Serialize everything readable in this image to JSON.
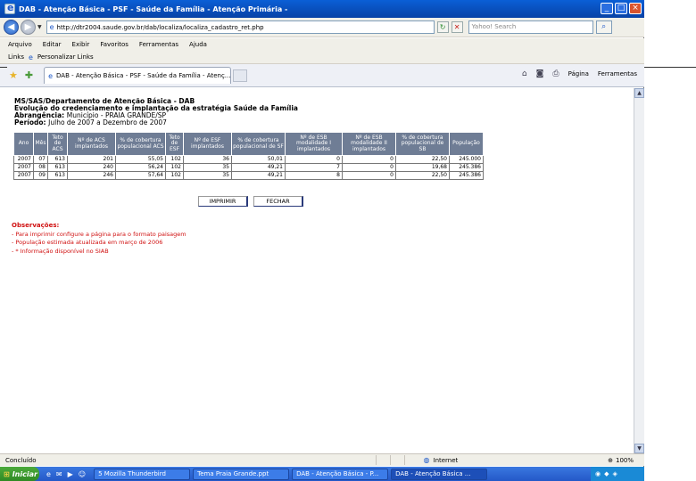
{
  "window": {
    "title": "DAB - Atenção Básica - PSF - Saúde da Família - Atenção Primária -",
    "buttons": [
      "_",
      "□",
      "×"
    ]
  },
  "address": {
    "url": "http://dtr2004.saude.gov.br/dab/localiza/localiza_cadastro_ret.php",
    "search_placeholder": "Yahoo! Search"
  },
  "menu": [
    "Arquivo",
    "Editar",
    "Exibir",
    "Favoritos",
    "Ferramentas",
    "Ajuda"
  ],
  "links": {
    "label": "Links",
    "item": "Personalizar Links"
  },
  "tab": {
    "label": "DAB - Atenção Básica - PSF - Saúde da Família - Atenç..."
  },
  "commands": {
    "page": "Página",
    "tools": "Ferramentas"
  },
  "report": {
    "line1": "MS/SAS/Departamento de Atenção Básica - DAB",
    "line2": "Evolução do credenciamento e implantação da estratégia Saúde da Família",
    "abrangencia_label": "Abrangência:",
    "abrangencia_value": "Município - PRAIA GRANDE/SP",
    "periodo_label": "Período:",
    "periodo_value": "Julho de 2007 a Dezembro de 2007"
  },
  "table": {
    "headers": [
      "Ano",
      "Mês",
      "Teto de ACS",
      "Nº de ACS implantados",
      "% de cobertura populacional ACS",
      "Teto de ESF",
      "Nº de ESF implantados",
      "% de cobertura populacional de SF",
      "Nº de ESB modalidade I implantados",
      "Nº de ESB modalidade II implantados",
      "% de cobertura populacional de SB",
      "População"
    ],
    "rows": [
      [
        "2007",
        "07",
        "613",
        "201",
        "55,05",
        "102",
        "36",
        "50,01",
        "0",
        "0",
        "22,50",
        "245.000"
      ],
      [
        "2007",
        "08",
        "613",
        "240",
        "56,24",
        "102",
        "35",
        "49,21",
        "7",
        "0",
        "19,68",
        "245.386"
      ],
      [
        "2007",
        "09",
        "613",
        "246",
        "57,64",
        "102",
        "35",
        "49,21",
        "8",
        "0",
        "22,50",
        "245.386"
      ]
    ]
  },
  "actions": {
    "print": "IMPRIMIR",
    "close": "FECHAR"
  },
  "observations": {
    "title": "Observações:",
    "items": [
      "- Para imprimir configure a página para o formato paisagem",
      "- População estimada atualizada em março de 2006",
      "- * Informação disponível no SIAB"
    ]
  },
  "status": {
    "text": "Concluído",
    "zone": "Internet",
    "zoom": "100%"
  },
  "taskbar": {
    "start": "Iniciar",
    "tasks": [
      "5 Mozilla Thunderbird",
      "Tema Praia Grande.ppt",
      "DAB - Atenção Básica - P...",
      "DAB - Atenção Básica ..."
    ]
  },
  "colors": {
    "titlebar": "#0a5fd6",
    "header_bg": "#6f7d95",
    "observation": "#d01010"
  }
}
